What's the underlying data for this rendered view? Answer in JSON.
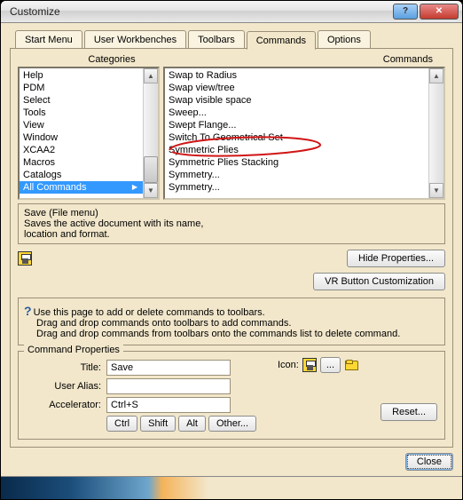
{
  "window": {
    "title": "Customize"
  },
  "tabs": [
    "Start Menu",
    "User Workbenches",
    "Toolbars",
    "Commands",
    "Options"
  ],
  "activeTab": 3,
  "headers": {
    "categories": "Categories",
    "commands": "Commands"
  },
  "categories": [
    "Help",
    "PDM",
    "Select",
    "Tools",
    "View",
    "Window",
    "XCAA2",
    "Macros",
    "Catalogs",
    "All Commands"
  ],
  "categorySelectedIndex": 9,
  "commands": [
    "Swap to Radius",
    "Swap view/tree",
    "Swap visible space",
    "Sweep...",
    "Swept Flange...",
    "Switch To Geometrical Set",
    "Symmetric Plies",
    "Symmetric Plies Stacking",
    "Symmetry...",
    "Symmetry..."
  ],
  "description": {
    "title": "Save (File menu)",
    "line1": "Saves the active document with its name,",
    "line2": "location and format."
  },
  "buttons": {
    "hideProps": "Hide Properties...",
    "vrCustom": "VR Button Customization",
    "reset": "Reset...",
    "close": "Close",
    "ctrl": "Ctrl",
    "shift": "Shift",
    "alt": "Alt",
    "other": "Other...",
    "elide": "..."
  },
  "help": {
    "line1": "Use this page to add or delete commands to toolbars.",
    "line2": "Drag and drop commands onto toolbars to add commands.",
    "line3": "Drag and drop commands from toolbars onto the commands list to delete command."
  },
  "commandProps": {
    "legend": "Command Properties",
    "titleLabel": "Title:",
    "titleValue": "Save",
    "aliasLabel": "User Alias:",
    "aliasValue": "",
    "accelLabel": "Accelerator:",
    "accelValue": "Ctrl+S",
    "iconLabel": "Icon:"
  }
}
